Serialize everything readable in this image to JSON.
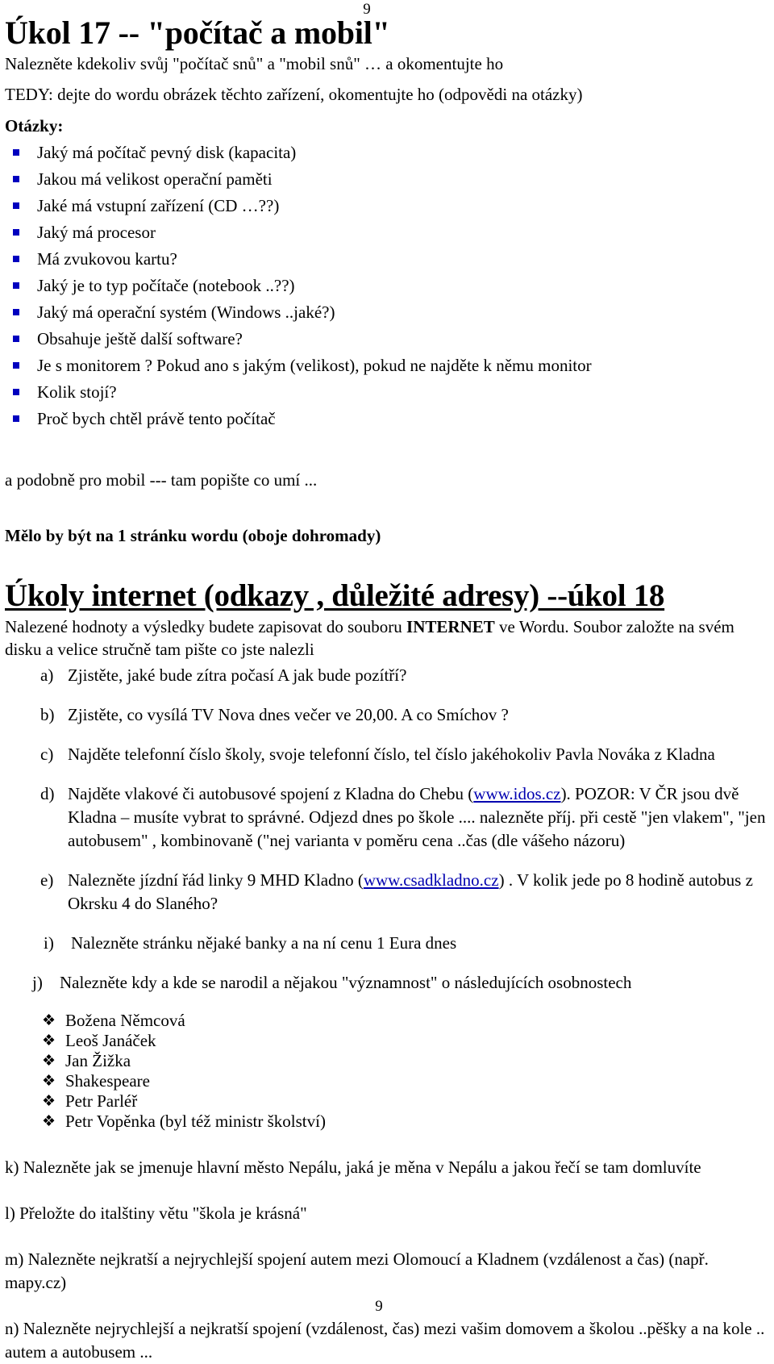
{
  "page": {
    "header_number": "9",
    "footer_number": "9"
  },
  "task17": {
    "title": "Úkol 17 -- \"počítač a mobil\"",
    "lead1": "Nalezněte kdekoliv svůj \"počítač snů\" a \"mobil snů\" … a okomentujte ho",
    "lead2": "TEDY:  dejte do wordu obrázek těchto zařízení, okomentujte ho (odpovědi na otázky)",
    "questions_label": "Otázky:",
    "questions": [
      "Jaký má počítač pevný disk (kapacita)",
      "Jakou má velikost operační paměti",
      "Jaké má vstupní zařízení (CD …??)",
      "Jaký má procesor",
      "Má zvukovou kartu?",
      "Jaký je to typ počítače (notebook ..??)",
      "Jaký má operační systém (Windows ..jaké?)",
      "Obsahuje ještě další software?",
      "Je s monitorem ? Pokud ano s jakým (velikost), pokud ne najděte k němu monitor",
      "Kolik stojí?",
      "Proč bych chtěl právě tento počítač"
    ],
    "mobile_note": "a podobně pro mobil  --- tam popište co umí ...",
    "page_note": "Mělo by být na 1 stránku wordu (oboje dohromady)",
    "bullet_color": "#0000bf"
  },
  "task18": {
    "title": "Úkoly internet   (odkazy , důležité adresy) --úkol 18",
    "intro_pre": "Nalezené hodnoty a výsledky  budete zapisovat do souboru ",
    "intro_bold": "INTERNET",
    "intro_post": " ve Wordu. Soubor založte na svém disku a velice stručně tam pište co jste nalezli",
    "items": {
      "a": {
        "marker": "a)",
        "text": "Zjistěte, jaké bude zítra počasí  A jak bude pozítří?"
      },
      "b": {
        "marker": "b)",
        "text": "Zjistěte, co vysílá TV Nova dnes večer ve 20,00. A co Smíchov ?"
      },
      "c": {
        "marker": "c)",
        "text": "Najděte telefonní číslo školy, svoje telefonní číslo, tel číslo jakéhokoliv Pavla Nováka z Kladna"
      },
      "d": {
        "marker": "d)",
        "pre": "Najděte vlakové či autobusové spojení z Kladna do Chebu (",
        "link": "www.idos.cz",
        "post": ").     POZOR:  V ČR jsou dvě Kladna – musíte vybrat to správné. Odjezd dnes po škole .... nalezněte příj. při cestě \"jen vlakem\", \"jen autobusem\" , kombinovaně (\"nej varianta v poměru cena ..čas   (dle vášeho názoru)"
      },
      "e": {
        "marker": "e)",
        "pre": "Nalezněte jízdní řád linky 9 MHD Kladno (",
        "link": "www.csadkladno.cz",
        "post": ") . V kolik jede po 8 hodině autobus z Okrsku 4 do Slaného?"
      },
      "i": {
        "marker": "i)",
        "text": "Nalezněte stránku nějaké banky a na ní cenu 1 Eura dnes"
      },
      "j": {
        "marker": "j)",
        "text": "Nalezněte kdy a kde se narodil a nějakou \"významnost\" o následujících osobnostech"
      }
    },
    "people": [
      "Božena Němcová",
      "Leoš Janáček",
      "Jan Žižka",
      "Shakespeare",
      " Petr Parléř",
      "Petr Vopěnka   (byl též ministr školství)"
    ],
    "people_bullet": "❖",
    "tail_k": "k) Nalezněte jak se jmenuje hlavní město Nepálu, jaká je měna v Nepálu a jakou řečí se tam domluvíte",
    "tail_l": "l) Přeložte do italštiny větu  \"škola je krásná\"",
    "tail_m": "m)   Nalezněte nejkratší a nejrychlejší spojení autem mezi Olomoucí a Kladnem  (vzdálenost a čas)  (např. mapy.cz)",
    "tail_n": "n) Nalezněte nejrychlejší a nejkratší spojení (vzdálenost, čas) mezi vašim domovem a školou ..pěšky a na kole .. autem a autobusem ...",
    "link_color": "#0000b0"
  }
}
